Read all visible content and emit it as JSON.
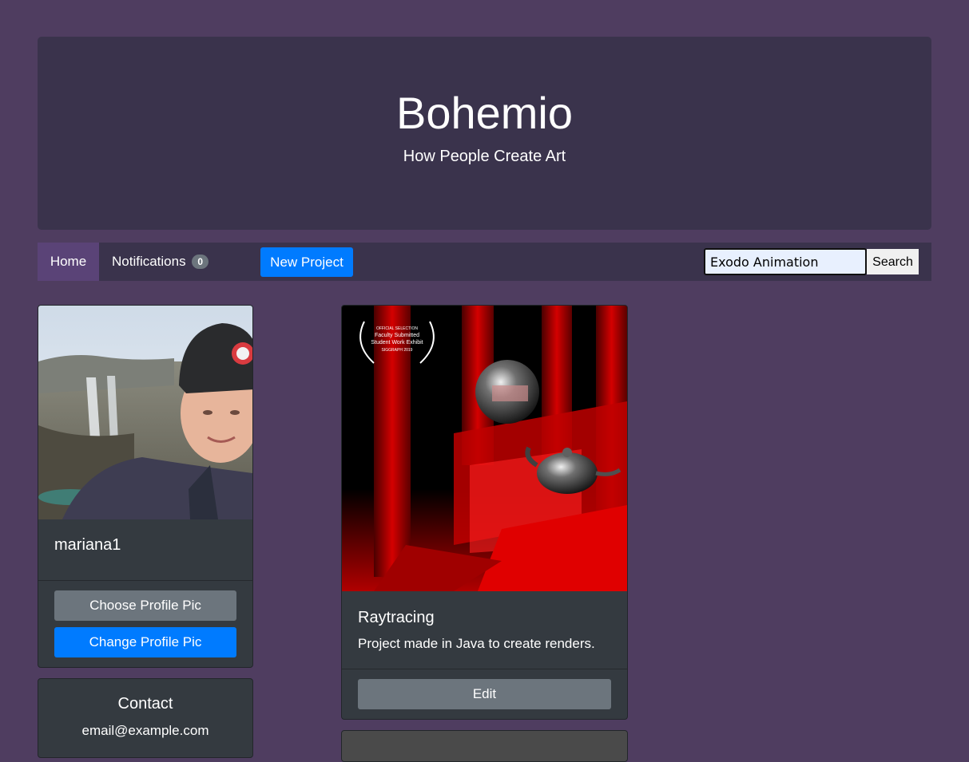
{
  "header": {
    "title": "Bohemio",
    "subtitle": "How People Create Art"
  },
  "nav": {
    "home_label": "Home",
    "notifications_label": "Notifications",
    "notifications_count": "0",
    "new_project_label": "New Project",
    "search_value": "Exodo Animation",
    "search_button_label": "Search"
  },
  "profile": {
    "username": "mariana1",
    "choose_pic_label": "Choose Profile Pic",
    "change_pic_label": "Change Profile Pic"
  },
  "contact": {
    "title": "Contact",
    "email": "email@example.com"
  },
  "projects": [
    {
      "title": "Raytracing",
      "description": "Project made in Java to create renders.",
      "edit_label": "Edit",
      "laurel_lines": [
        "OFFICIAL SELECTION",
        "Faculty Submitted",
        "Student Work Exhibit",
        "SIGGRAPH 2019"
      ]
    }
  ],
  "colors": {
    "page_bg": "#4f3d60",
    "panel_bg": "#3a334c",
    "active_nav": "#5a4377",
    "card_bg": "#343a40",
    "primary": "#007bff",
    "secondary": "#6c757d"
  }
}
